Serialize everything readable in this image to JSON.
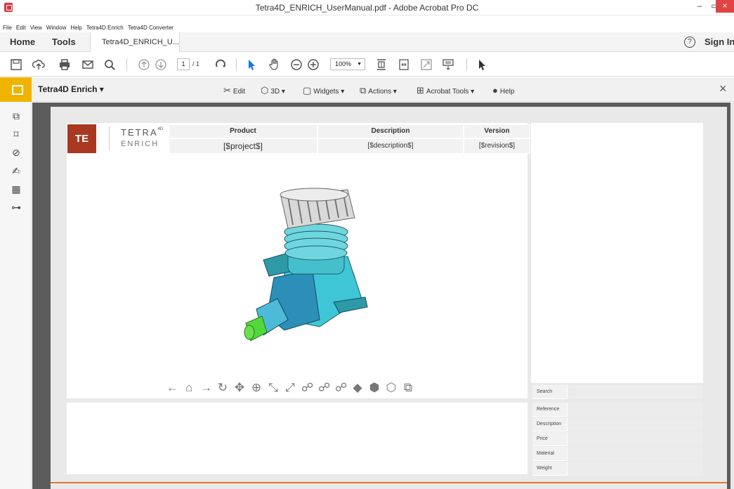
{
  "window": {
    "title": "Tetra4D_ENRICH_UserManual.pdf - Adobe Acrobat Pro DC",
    "minimize": "–",
    "maximize": "▭",
    "close": "×"
  },
  "menu": {
    "items": [
      "File",
      "Edit",
      "View",
      "Window",
      "Help",
      "Tetra4D Enrich",
      "Tetra4D Converter"
    ]
  },
  "tabs": {
    "home": "Home",
    "tools": "Tools",
    "document": "Tetra4D_ENRICH_U...",
    "document_close": "×",
    "help": "?",
    "sign_in": "Sign In"
  },
  "toolbar": {
    "page_current": "1",
    "page_total": "/ 1",
    "zoom": "100%"
  },
  "enrich": {
    "name": "Tetra4D Enrich ▾",
    "edit": "Edit",
    "three_d": "3D ▾",
    "widgets": "Widgets ▾",
    "actions": "Actions ▾",
    "acrobat_tools": "Acrobat Tools ▾",
    "help": "Help",
    "close": "×"
  },
  "document": {
    "logo": "TE",
    "brand_line1": "TETRA",
    "brand_sup": "4D",
    "brand_line2": "ENRICH",
    "header": {
      "product_label": "Product",
      "description_label": "Description",
      "version_label": "Version",
      "product_value": "[$project$]",
      "description_value": "[$description$]",
      "version_value": "[$revision$]"
    },
    "properties": {
      "search": "Search",
      "reference": "Reference",
      "description": "Description",
      "price": "Price",
      "material": "Material",
      "weight": "Weight"
    }
  },
  "colors": {
    "logo_bg": "#a8381f",
    "enrich_accent": "#f0b400",
    "orange_line": "#e8772e",
    "close_button": "#e04343"
  }
}
